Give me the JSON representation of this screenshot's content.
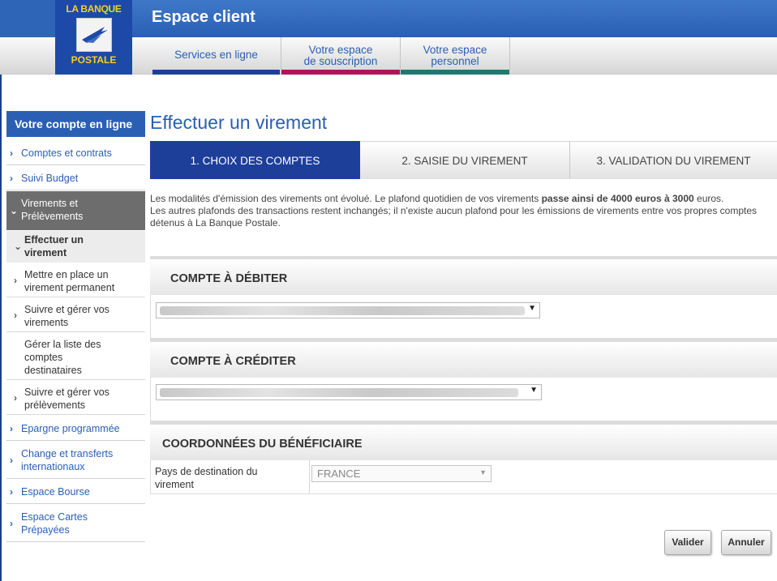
{
  "header": {
    "app_title": "Espace client",
    "logo_top": "LA BANQUE",
    "logo_bottom": "POSTALE",
    "tabs": [
      {
        "line1": "Services en ligne",
        "line2": "",
        "color": "#1d3f9a"
      },
      {
        "line1": "Votre espace",
        "line2": "de souscription",
        "color": "#b0155a"
      },
      {
        "line1": "Votre espace",
        "line2": "personnel",
        "color": "#1d7a6e"
      }
    ]
  },
  "sidebar": {
    "title": "Votre compte en ligne",
    "items": [
      {
        "line1": "Comptes et contrats",
        "line2": ""
      },
      {
        "line1": "Suivi Budget",
        "line2": ""
      },
      {
        "line1": "Virements et",
        "line2": "Prélèvements"
      },
      {
        "line1": "Effectuer un",
        "line2": "virement"
      },
      {
        "line1": "Mettre en place un",
        "line2": "virement permanent"
      },
      {
        "line1": "Suivre et gérer vos",
        "line2": "virements"
      },
      {
        "line1": "Gérer la liste des",
        "line2": "comptes",
        "line3": "destinataires"
      },
      {
        "line1": "Suivre et gérer vos",
        "line2": "prélèvements"
      },
      {
        "line1": "Epargne programmée",
        "line2": ""
      },
      {
        "line1": "Change et transferts",
        "line2": "internationaux"
      },
      {
        "line1": "Espace Bourse",
        "line2": ""
      },
      {
        "line1": "Espace Cartes",
        "line2": "Prépayées"
      }
    ]
  },
  "main": {
    "title": "Effectuer un virement",
    "steps": [
      "1. CHOIX DES COMPTES",
      "2. SAISIE DU VIREMENT",
      "3. VALIDATION DU VIREMENT"
    ],
    "notice": {
      "p1_start": "Les modalités d'émission des virements ont évolué. Le plafond quotidien de vos virements ",
      "p1_bold": "passe ainsi de 4000 euros à 3000",
      "p1_end": " euros.",
      "p2": "Les autres plafonds des transactions restent inchangés; il n'existe aucun plafond pour les émissions de virements entre vos propres comptes",
      "p3": "détenus à La Banque Postale."
    },
    "sections": {
      "debit": "COMPTE À DÉBITER",
      "credit": "COMPTE À CRÉDITER",
      "beneficiary": "COORDONNÉES DU BÉNÉFICIAIRE"
    },
    "beneficiary": {
      "country_label_line1": "Pays de destination du",
      "country_label_line2": "virement",
      "country_value": "FRANCE"
    },
    "buttons": {
      "validate": "Valider",
      "cancel": "Annuler"
    }
  }
}
